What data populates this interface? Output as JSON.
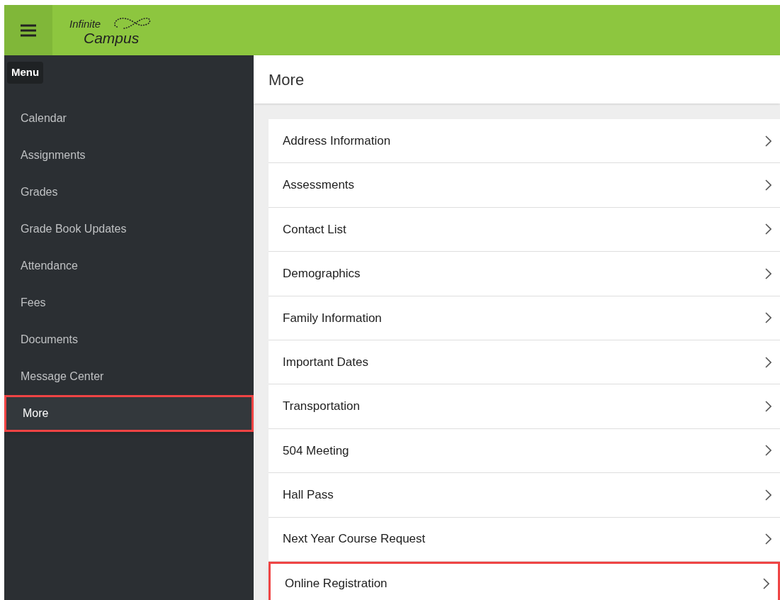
{
  "header": {
    "logo": {
      "line_1": "Infinite",
      "line_2": "Campus"
    },
    "menu_tooltip": "Menu"
  },
  "sidebar": {
    "items": [
      {
        "label": "Calendar",
        "selected": false,
        "highlighted": false
      },
      {
        "label": "Assignments",
        "selected": false,
        "highlighted": false
      },
      {
        "label": "Grades",
        "selected": false,
        "highlighted": false
      },
      {
        "label": "Grade Book Updates",
        "selected": false,
        "highlighted": false
      },
      {
        "label": "Attendance",
        "selected": false,
        "highlighted": false
      },
      {
        "label": "Fees",
        "selected": false,
        "highlighted": false
      },
      {
        "label": "Documents",
        "selected": false,
        "highlighted": false
      },
      {
        "label": "Message Center",
        "selected": false,
        "highlighted": false
      },
      {
        "label": "More",
        "selected": true,
        "highlighted": true
      }
    ]
  },
  "page": {
    "title": "More",
    "items": [
      {
        "label": "Address Information",
        "highlighted": false
      },
      {
        "label": "Assessments",
        "highlighted": false
      },
      {
        "label": "Contact List",
        "highlighted": false
      },
      {
        "label": "Demographics",
        "highlighted": false
      },
      {
        "label": "Family Information",
        "highlighted": false
      },
      {
        "label": "Important Dates",
        "highlighted": false
      },
      {
        "label": "Transportation",
        "highlighted": false
      },
      {
        "label": "504 Meeting",
        "highlighted": false
      },
      {
        "label": "Hall Pass",
        "highlighted": false
      },
      {
        "label": "Next Year Course Request",
        "highlighted": false
      },
      {
        "label": "Online Registration",
        "highlighted": true
      }
    ]
  }
}
